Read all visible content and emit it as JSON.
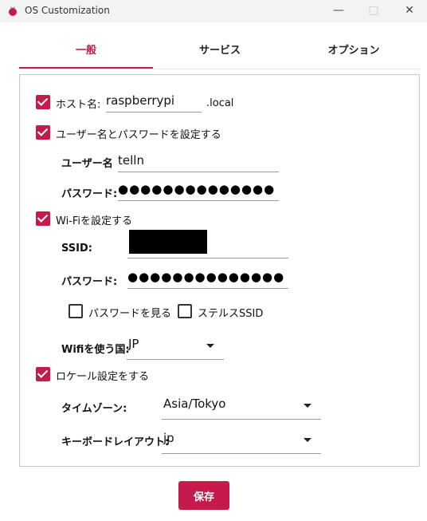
{
  "window": {
    "title": "OS Customization",
    "minimize_icon": "minimize-icon",
    "maximize_icon": "maximize-icon",
    "close_icon": "close-icon",
    "app_icon": "raspberry-icon"
  },
  "tabs": [
    {
      "label": "一般",
      "active": true
    },
    {
      "label": "サービス",
      "active": false
    },
    {
      "label": "オプション",
      "active": false
    }
  ],
  "general": {
    "hostname": {
      "checked": true,
      "label": "ホスト名:",
      "value": "raspberrypi",
      "suffix": ".local"
    },
    "user": {
      "checked": true,
      "label": "ユーザー名とパスワードを設定する",
      "username_label": "ユーザー名",
      "username_value": "telln",
      "password_label": "パスワード:",
      "password_value": "●●●●●●●●●●●●●●"
    },
    "wifi": {
      "checked": true,
      "label": "Wi-Fiを設定する",
      "ssid_label": "SSID:",
      "password_label": "パスワード:",
      "password_value": "●●●●●●●●●●●●●●",
      "show_password": {
        "checked": false,
        "label": "パスワードを見る"
      },
      "stealth_ssid": {
        "checked": false,
        "label": "ステルスSSID"
      },
      "country_label": "Wifiを使う国:",
      "country_value": "JP"
    },
    "locale": {
      "checked": true,
      "label": "ロケール設定をする",
      "timezone_label": "タイムゾーン:",
      "timezone_value": "Asia/Tokyo",
      "keyboard_label": "キーボードレイアウト:",
      "keyboard_value": "jp"
    }
  },
  "footer": {
    "save_label": "保存"
  },
  "colors": {
    "accent": "#c51a4a",
    "titlebar": "#f3f3f3",
    "panel_border": "#c8c8c8"
  }
}
